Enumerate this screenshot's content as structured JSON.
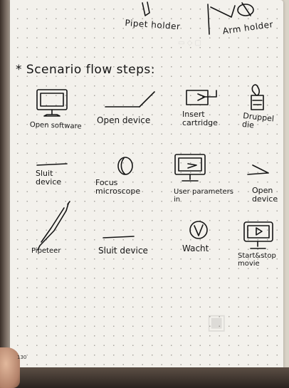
{
  "top_labels": {
    "pipet_holder": "Pipet holder",
    "arm_holder": "Arm holder"
  },
  "heading": "* Scenario flow steps:",
  "steps": [
    {
      "label": "Open software",
      "icon": "monitor-icon"
    },
    {
      "label": "Open device",
      "icon": "open-lid-icon"
    },
    {
      "label": "Insert\ncartridge",
      "icon": "cartridge-insert-icon"
    },
    {
      "label": "Druppel\ndie",
      "icon": "droplet-bottle-icon"
    },
    {
      "label": "Sluit\ndevice",
      "icon": "closed-lid-icon"
    },
    {
      "label": "Focus\nmicroscope",
      "icon": "focus-lens-icon"
    },
    {
      "label": "User parameters\nin",
      "icon": "monitor-input-icon"
    },
    {
      "label": "Open\ndevice",
      "icon": "open-lid-icon"
    },
    {
      "label": "Pipeteer",
      "icon": "pipette-icon"
    },
    {
      "label": "Sluit device",
      "icon": "closed-lid-icon"
    },
    {
      "label": "Wacht",
      "icon": "clock-icon"
    },
    {
      "label": "Start&stop\nmovie",
      "icon": "monitor-play-icon"
    }
  ],
  "page_number": "130",
  "colors": {
    "ink": "#151515",
    "paper": "#f3f1ec",
    "dots": "#a9a6a0"
  }
}
